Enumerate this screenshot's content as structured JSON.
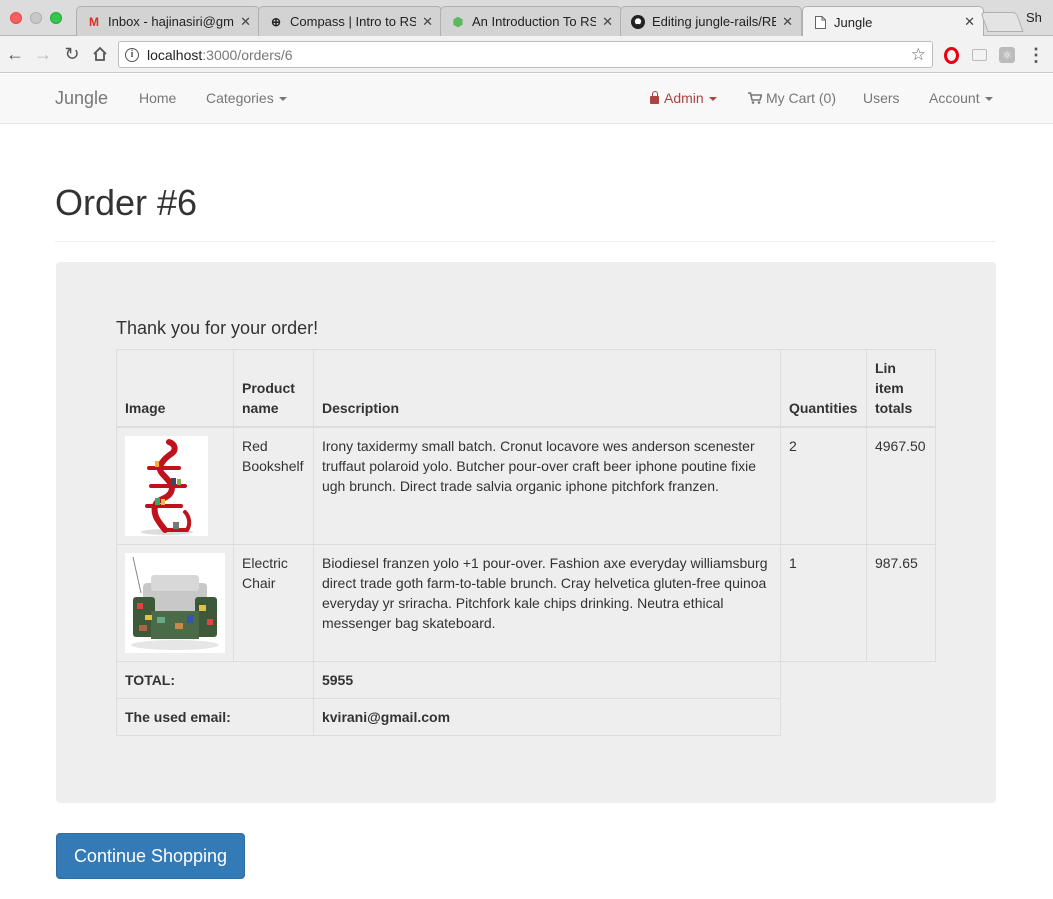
{
  "browser": {
    "tabs": [
      {
        "title": "Inbox - hajinasiri@gma",
        "icon": "gmail-icon"
      },
      {
        "title": "Compass | Intro to RS|",
        "icon": "compass-icon"
      },
      {
        "title": "An Introduction To RS|",
        "icon": "introduction-icon"
      },
      {
        "title": "Editing jungle-rails/RE",
        "icon": "github-icon"
      },
      {
        "title": "Jungle",
        "icon": "page-icon"
      }
    ],
    "profile": "Sh",
    "url_host": "localhost",
    "url_path": ":3000/orders/6"
  },
  "navbar": {
    "brand": "Jungle",
    "home": "Home",
    "categories": "Categories",
    "admin": "Admin",
    "cart": "My Cart (0)",
    "users": "Users",
    "account": "Account"
  },
  "page": {
    "title": "Order #6",
    "thanks": "Thank you for your order!",
    "continue_button": "Continue Shopping"
  },
  "table": {
    "headers": {
      "image": "Image",
      "product_name": "Product name",
      "description": "Description",
      "quantities": "Quantities",
      "line_totals": "Lin item totals"
    },
    "rows": [
      {
        "name": "Red Bookshelf",
        "description": "Irony taxidermy small batch. Cronut locavore wes anderson scenester truffaut polaroid yolo. Butcher pour-over craft beer iphone poutine fixie ugh brunch. Direct trade salvia organic iphone pitchfork franzen.",
        "quantity": "2",
        "total": "4967.50"
      },
      {
        "name": "Electric Chair",
        "description": "Biodiesel franzen yolo +1 pour-over. Fashion axe everyday williamsburg direct trade goth farm-to-table brunch. Cray helvetica gluten-free quinoa everyday yr sriracha. Pitchfork kale chips drinking. Neutra ethical messenger bag skateboard.",
        "quantity": "1",
        "total": "987.65"
      }
    ],
    "footer": {
      "total_label": "TOTAL:",
      "total_value": "5955",
      "email_label": "The used email:",
      "email_value": "kvirani@gmail.com"
    }
  },
  "colors": {
    "primary": "#337ab7",
    "admin": "#a94442",
    "well": "#eeeeee"
  }
}
